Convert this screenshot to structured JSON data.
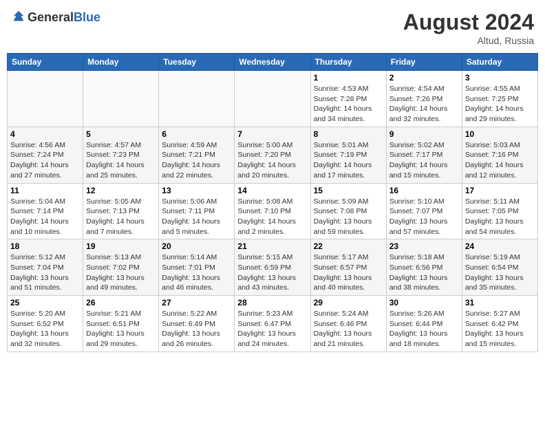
{
  "header": {
    "logo_general": "General",
    "logo_blue": "Blue",
    "month_year": "August 2024",
    "location": "Altud, Russia"
  },
  "weekdays": [
    "Sunday",
    "Monday",
    "Tuesday",
    "Wednesday",
    "Thursday",
    "Friday",
    "Saturday"
  ],
  "weeks": [
    [
      {
        "day": "",
        "info": ""
      },
      {
        "day": "",
        "info": ""
      },
      {
        "day": "",
        "info": ""
      },
      {
        "day": "",
        "info": ""
      },
      {
        "day": "1",
        "info": "Sunrise: 4:53 AM\nSunset: 7:28 PM\nDaylight: 14 hours\nand 34 minutes."
      },
      {
        "day": "2",
        "info": "Sunrise: 4:54 AM\nSunset: 7:26 PM\nDaylight: 14 hours\nand 32 minutes."
      },
      {
        "day": "3",
        "info": "Sunrise: 4:55 AM\nSunset: 7:25 PM\nDaylight: 14 hours\nand 29 minutes."
      }
    ],
    [
      {
        "day": "4",
        "info": "Sunrise: 4:56 AM\nSunset: 7:24 PM\nDaylight: 14 hours\nand 27 minutes."
      },
      {
        "day": "5",
        "info": "Sunrise: 4:57 AM\nSunset: 7:23 PM\nDaylight: 14 hours\nand 25 minutes."
      },
      {
        "day": "6",
        "info": "Sunrise: 4:59 AM\nSunset: 7:21 PM\nDaylight: 14 hours\nand 22 minutes."
      },
      {
        "day": "7",
        "info": "Sunrise: 5:00 AM\nSunset: 7:20 PM\nDaylight: 14 hours\nand 20 minutes."
      },
      {
        "day": "8",
        "info": "Sunrise: 5:01 AM\nSunset: 7:19 PM\nDaylight: 14 hours\nand 17 minutes."
      },
      {
        "day": "9",
        "info": "Sunrise: 5:02 AM\nSunset: 7:17 PM\nDaylight: 14 hours\nand 15 minutes."
      },
      {
        "day": "10",
        "info": "Sunrise: 5:03 AM\nSunset: 7:16 PM\nDaylight: 14 hours\nand 12 minutes."
      }
    ],
    [
      {
        "day": "11",
        "info": "Sunrise: 5:04 AM\nSunset: 7:14 PM\nDaylight: 14 hours\nand 10 minutes."
      },
      {
        "day": "12",
        "info": "Sunrise: 5:05 AM\nSunset: 7:13 PM\nDaylight: 14 hours\nand 7 minutes."
      },
      {
        "day": "13",
        "info": "Sunrise: 5:06 AM\nSunset: 7:11 PM\nDaylight: 14 hours\nand 5 minutes."
      },
      {
        "day": "14",
        "info": "Sunrise: 5:08 AM\nSunset: 7:10 PM\nDaylight: 14 hours\nand 2 minutes."
      },
      {
        "day": "15",
        "info": "Sunrise: 5:09 AM\nSunset: 7:08 PM\nDaylight: 13 hours\nand 59 minutes."
      },
      {
        "day": "16",
        "info": "Sunrise: 5:10 AM\nSunset: 7:07 PM\nDaylight: 13 hours\nand 57 minutes."
      },
      {
        "day": "17",
        "info": "Sunrise: 5:11 AM\nSunset: 7:05 PM\nDaylight: 13 hours\nand 54 minutes."
      }
    ],
    [
      {
        "day": "18",
        "info": "Sunrise: 5:12 AM\nSunset: 7:04 PM\nDaylight: 13 hours\nand 51 minutes."
      },
      {
        "day": "19",
        "info": "Sunrise: 5:13 AM\nSunset: 7:02 PM\nDaylight: 13 hours\nand 49 minutes."
      },
      {
        "day": "20",
        "info": "Sunrise: 5:14 AM\nSunset: 7:01 PM\nDaylight: 13 hours\nand 46 minutes."
      },
      {
        "day": "21",
        "info": "Sunrise: 5:15 AM\nSunset: 6:59 PM\nDaylight: 13 hours\nand 43 minutes."
      },
      {
        "day": "22",
        "info": "Sunrise: 5:17 AM\nSunset: 6:57 PM\nDaylight: 13 hours\nand 40 minutes."
      },
      {
        "day": "23",
        "info": "Sunrise: 5:18 AM\nSunset: 6:56 PM\nDaylight: 13 hours\nand 38 minutes."
      },
      {
        "day": "24",
        "info": "Sunrise: 5:19 AM\nSunset: 6:54 PM\nDaylight: 13 hours\nand 35 minutes."
      }
    ],
    [
      {
        "day": "25",
        "info": "Sunrise: 5:20 AM\nSunset: 6:52 PM\nDaylight: 13 hours\nand 32 minutes."
      },
      {
        "day": "26",
        "info": "Sunrise: 5:21 AM\nSunset: 6:51 PM\nDaylight: 13 hours\nand 29 minutes."
      },
      {
        "day": "27",
        "info": "Sunrise: 5:22 AM\nSunset: 6:49 PM\nDaylight: 13 hours\nand 26 minutes."
      },
      {
        "day": "28",
        "info": "Sunrise: 5:23 AM\nSunset: 6:47 PM\nDaylight: 13 hours\nand 24 minutes."
      },
      {
        "day": "29",
        "info": "Sunrise: 5:24 AM\nSunset: 6:46 PM\nDaylight: 13 hours\nand 21 minutes."
      },
      {
        "day": "30",
        "info": "Sunrise: 5:26 AM\nSunset: 6:44 PM\nDaylight: 13 hours\nand 18 minutes."
      },
      {
        "day": "31",
        "info": "Sunrise: 5:27 AM\nSunset: 6:42 PM\nDaylight: 13 hours\nand 15 minutes."
      }
    ]
  ]
}
